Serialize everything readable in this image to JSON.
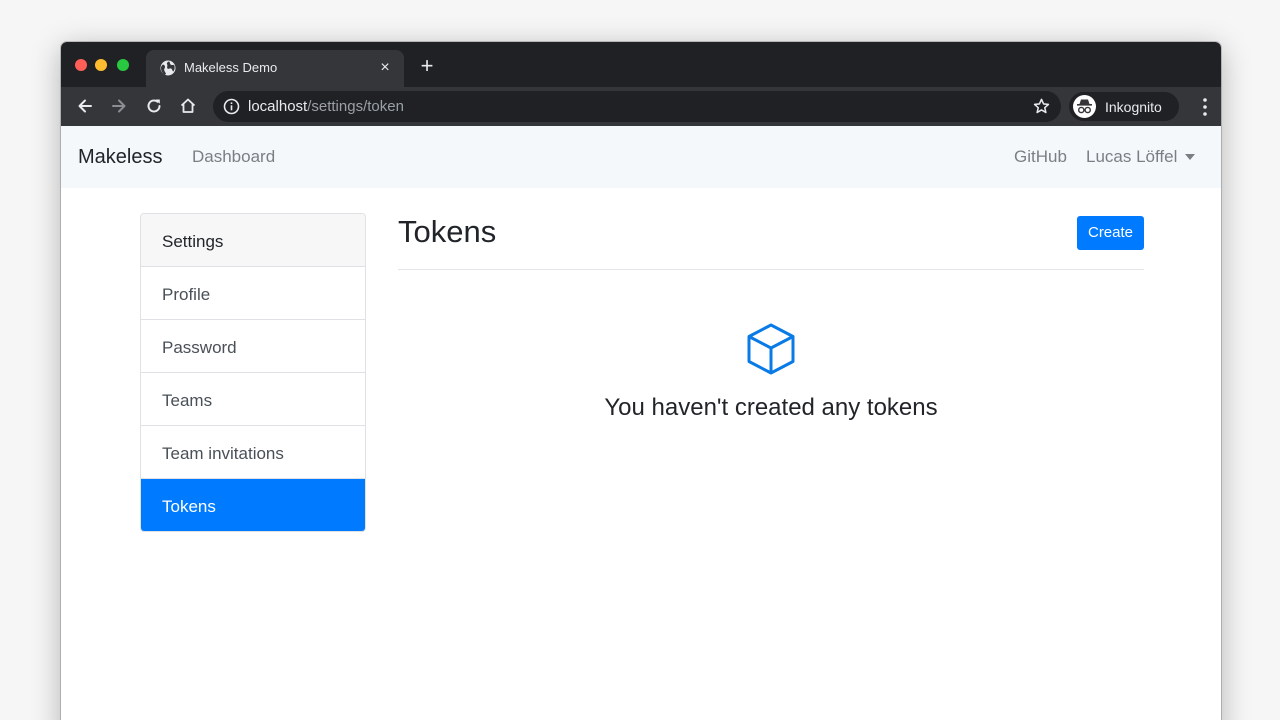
{
  "browser": {
    "tab_title": "Makeless Demo",
    "tab_close": "×",
    "new_tab": "+",
    "url_host": "localhost",
    "url_path": "/settings/token",
    "profile_label": "Inkognito"
  },
  "navbar": {
    "brand": "Makeless",
    "dashboard": "Dashboard",
    "github": "GitHub",
    "user": "Lucas Löffel"
  },
  "sidebar": {
    "header": "Settings",
    "items": [
      {
        "label": "Profile"
      },
      {
        "label": "Password"
      },
      {
        "label": "Teams"
      },
      {
        "label": "Team invitations"
      },
      {
        "label": "Tokens"
      }
    ],
    "active_index": 4
  },
  "main": {
    "title": "Tokens",
    "create_label": "Create",
    "empty_message": "You haven't created any tokens",
    "empty_icon": "box-icon"
  },
  "colors": {
    "accent": "#007bff",
    "chrome_dark": "#202124",
    "chrome_tab": "#35363a",
    "navbar_bg": "#f5f8fb"
  }
}
